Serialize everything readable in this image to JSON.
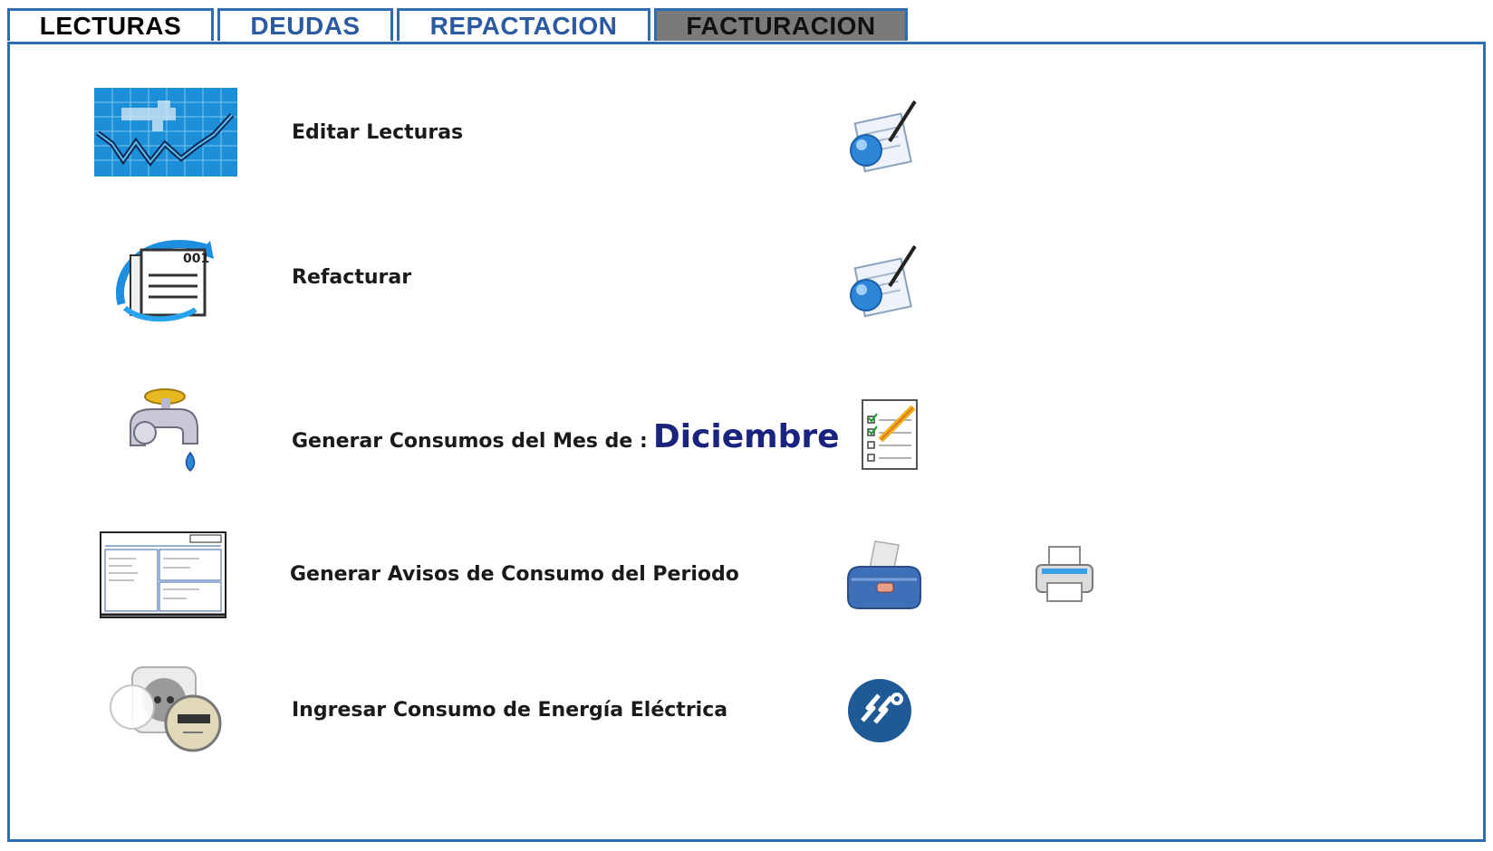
{
  "tabs": [
    {
      "label": "LECTURAS"
    },
    {
      "label": "DEUDAS"
    },
    {
      "label": "REPACTACION"
    },
    {
      "label": "FACTURACION"
    }
  ],
  "rows": [
    {
      "label": "Editar Lecturas",
      "icon": "water-meter-chart-icon",
      "action_icon": "edit-document-icon"
    },
    {
      "label": "Refacturar",
      "icon": "invoice-refresh-icon",
      "action_icon": "edit-document-icon"
    },
    {
      "label": "Generar Consumos del Mes de :",
      "month": "Diciembre",
      "icon": "water-faucet-icon",
      "action_icon": "checklist-pencil-icon"
    },
    {
      "label": "Generar Avisos de Consumo del Periodo",
      "icon": "consumption-notice-form-icon",
      "action_icons": [
        "receipt-printer-icon",
        "printer-icon"
      ]
    },
    {
      "label": "Ingresar Consumo de Energía Eléctrica",
      "icon": "electric-meter-icon",
      "action_icon": "electricity-icon"
    }
  ],
  "colors": {
    "accent": "#2e6db4",
    "active_tab": "#7a7a7a",
    "month_text": "#1a237e"
  }
}
